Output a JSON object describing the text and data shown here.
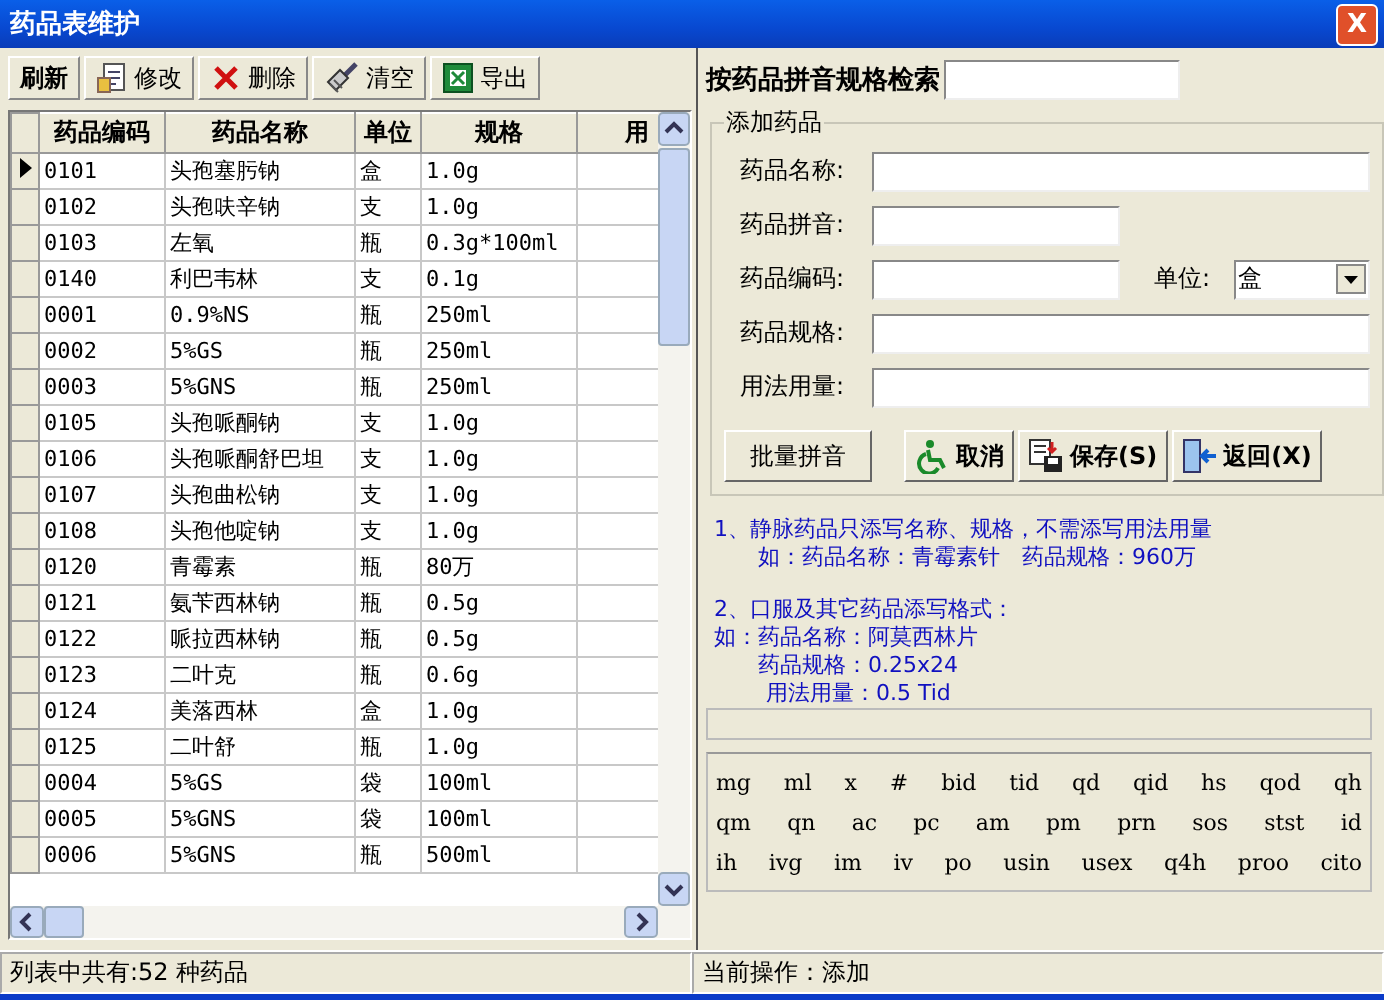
{
  "window": {
    "title": "药品表维护",
    "close": "X"
  },
  "toolbar": [
    {
      "label": "刷新",
      "kind": "plain"
    },
    {
      "label": "修改",
      "kind": "edit"
    },
    {
      "label": "删除",
      "kind": "delete"
    },
    {
      "label": "清空",
      "kind": "clear"
    },
    {
      "label": "导出",
      "kind": "export"
    }
  ],
  "table": {
    "columns": [
      "药品编码",
      "药品名称",
      "单位",
      "规格",
      "用"
    ],
    "rows": [
      {
        "code": "0101",
        "name": "头孢塞肟钠",
        "unit": "盒",
        "spec": "1.0g",
        "selected": true
      },
      {
        "code": "0102",
        "name": "头孢呋辛钠",
        "unit": "支",
        "spec": "1.0g",
        "selected": false
      },
      {
        "code": "0103",
        "name": "左氧",
        "unit": "瓶",
        "spec": "0.3g*100ml",
        "selected": false
      },
      {
        "code": "0140",
        "name": "利巴韦林",
        "unit": "支",
        "spec": "0.1g",
        "selected": false
      },
      {
        "code": "0001",
        "name": "0.9%NS",
        "unit": "瓶",
        "spec": "250ml",
        "selected": false
      },
      {
        "code": "0002",
        "name": "5%GS",
        "unit": "瓶",
        "spec": "250ml",
        "selected": false
      },
      {
        "code": "0003",
        "name": "5%GNS",
        "unit": "瓶",
        "spec": "250ml",
        "selected": false
      },
      {
        "code": "0105",
        "name": "头孢哌酮钠",
        "unit": "支",
        "spec": "1.0g",
        "selected": false
      },
      {
        "code": "0106",
        "name": "头孢哌酮舒巴坦",
        "unit": "支",
        "spec": "1.0g",
        "selected": false
      },
      {
        "code": "0107",
        "name": "头孢曲松钠",
        "unit": "支",
        "spec": "1.0g",
        "selected": false
      },
      {
        "code": "0108",
        "name": "头孢他啶钠",
        "unit": "支",
        "spec": "1.0g",
        "selected": false
      },
      {
        "code": "0120",
        "name": "青霉素",
        "unit": "瓶",
        "spec": "80万",
        "selected": false
      },
      {
        "code": "0121",
        "name": "氨苄西林钠",
        "unit": "瓶",
        "spec": "0.5g",
        "selected": false
      },
      {
        "code": "0122",
        "name": "哌拉西林钠",
        "unit": "瓶",
        "spec": "0.5g",
        "selected": false
      },
      {
        "code": "0123",
        "name": "二叶克",
        "unit": "瓶",
        "spec": "0.6g",
        "selected": false
      },
      {
        "code": "0124",
        "name": "美落西林",
        "unit": "盒",
        "spec": "1.0g",
        "selected": false
      },
      {
        "code": "0125",
        "name": "二叶舒",
        "unit": "瓶",
        "spec": "1.0g",
        "selected": false
      },
      {
        "code": "0004",
        "name": "5%GS",
        "unit": "袋",
        "spec": "100ml",
        "selected": false
      },
      {
        "code": "0005",
        "name": "5%GNS",
        "unit": "袋",
        "spec": "100ml",
        "selected": false
      },
      {
        "code": "0006",
        "name": "5%GNS",
        "unit": "瓶",
        "spec": "500ml",
        "selected": false
      }
    ]
  },
  "search": {
    "label": "按药品拼音规格检索"
  },
  "form": {
    "title": "添加药品",
    "fields": [
      {
        "label": "药品名称:",
        "kind": "wide"
      },
      {
        "label": "药品拼音:",
        "kind": "short"
      },
      {
        "label": "药品编码:",
        "kind": "short"
      },
      {
        "label": "药品规格:",
        "kind": "wide"
      },
      {
        "label": "用法用量:",
        "kind": "wide"
      }
    ],
    "unit": {
      "label": "单位:",
      "value": "盒"
    },
    "buttons": [
      {
        "label": "批量拼音",
        "kind": "plain"
      },
      {
        "label": "取消",
        "kind": "cancel"
      },
      {
        "label": "保存(S)",
        "kind": "save"
      },
      {
        "label": "返回(X)",
        "kind": "back"
      }
    ]
  },
  "hints": [
    {
      "text": "1、静脉药品只添写名称、规格，不需添写用法用量",
      "kind": "line"
    },
    {
      "text": "如：药品名称：青霉素针　药品规格：960万",
      "kind": "indent"
    },
    {
      "text": "2、口服及其它药品添写格式：",
      "kind": "gap"
    },
    {
      "text": "如：药品名称：阿莫西林片",
      "kind": "line"
    },
    {
      "text": "药品规格：0.25x24",
      "kind": "indent"
    },
    {
      "text": "用法用量：0.5 Tid",
      "kind": "indent2"
    }
  ],
  "abbreviations": [
    [
      "mg",
      "ml",
      "x",
      "#",
      "bid",
      "tid",
      "qd",
      "qid",
      "hs",
      "qod",
      "qh"
    ],
    [
      "qm",
      "qn",
      "ac",
      "pc",
      "am",
      "pm",
      "prn",
      "sos",
      "stst",
      "id"
    ],
    [
      "ih",
      "ivg",
      "im",
      "iv",
      "po",
      "usin",
      "usex",
      "q4h",
      "proo",
      "cito"
    ]
  ],
  "status_bar": {
    "left": "列表中共有:52 种药品",
    "right": "当前操作：添加"
  }
}
